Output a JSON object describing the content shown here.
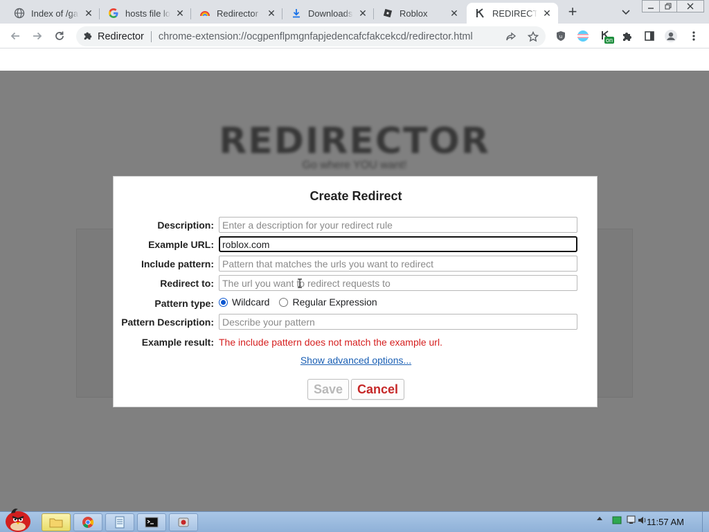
{
  "browser": {
    "tabs": [
      {
        "title": "Index of /ga",
        "icon": "globe-icon",
        "active": false
      },
      {
        "title": "hosts file lo",
        "icon": "google-icon",
        "active": false
      },
      {
        "title": "Redirector -",
        "icon": "rainbow-icon",
        "active": false
      },
      {
        "title": "Downloads",
        "icon": "download-icon",
        "active": false
      },
      {
        "title": "Roblox",
        "icon": "roblox-icon",
        "active": false
      },
      {
        "title": "REDIRECTO",
        "icon": "redirector-icon",
        "active": true
      }
    ],
    "new_tab_label": "+",
    "address_bar": {
      "site_chip": "Redirector",
      "url": "chrome-extension://ocgpenflpmgnfapjedencafcfakcekcd/redirector.html"
    },
    "extension_badge": "on"
  },
  "page": {
    "heading": "REDIRECTOR",
    "tagline": "Go where YOU want!"
  },
  "dialog": {
    "title": "Create Redirect",
    "fields": {
      "description": {
        "label": "Description:",
        "value": "",
        "placeholder": "Enter a description for your redirect rule"
      },
      "example_url": {
        "label": "Example URL:",
        "value": "roblox.com",
        "placeholder": ""
      },
      "include_pattern": {
        "label": "Include pattern:",
        "value": "",
        "placeholder": "Pattern that matches the urls you want to redirect"
      },
      "redirect_to": {
        "label": "Redirect to:",
        "value": "",
        "placeholder": "The url you want to redirect requests to"
      },
      "pattern_type": {
        "label": "Pattern type:",
        "options": [
          "Wildcard",
          "Regular Expression"
        ],
        "selected": "Wildcard"
      },
      "pattern_description": {
        "label": "Pattern Description:",
        "value": "",
        "placeholder": "Describe your pattern"
      },
      "example_result": {
        "label": "Example result:",
        "value": "The include pattern does not match the example url."
      }
    },
    "advanced_link": "Show advanced options...",
    "save_label": "Save",
    "cancel_label": "Cancel"
  },
  "taskbar": {
    "clock": "11:57 AM"
  },
  "colors": {
    "overlay": "#808080",
    "error": "#d51f1f",
    "link": "#1a5fb4",
    "cancel": "#c62828",
    "save_disabled": "#b9b9b9"
  }
}
